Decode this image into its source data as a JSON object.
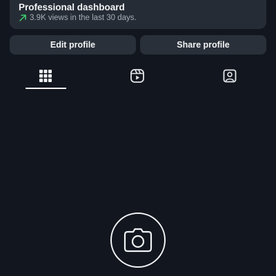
{
  "dashboard": {
    "title": "Professional dashboard",
    "subtitle": "3.9K views in the last 30 days.",
    "trend_icon": "arrow-up-right-icon",
    "trend_color": "#3fcf72"
  },
  "buttons": {
    "edit_profile": "Edit profile",
    "share_profile": "Share profile"
  },
  "tabs": [
    {
      "icon": "grid-icon",
      "selected": true
    },
    {
      "icon": "reels-icon",
      "selected": false
    },
    {
      "icon": "tagged-icon",
      "selected": false
    }
  ],
  "empty_state": {
    "icon": "camera-icon"
  },
  "colors": {
    "background": "#12171f",
    "card": "#262c35",
    "button": "#2a3039",
    "text": "#f2f4f6",
    "muted_text": "#a6adb7"
  }
}
